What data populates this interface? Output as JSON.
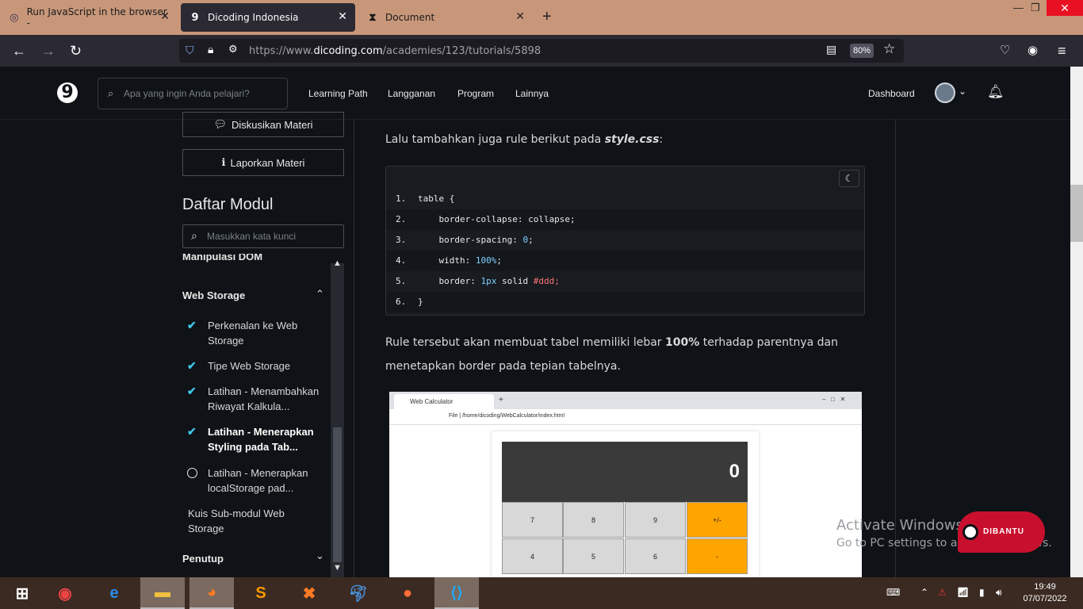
{
  "browser": {
    "tabs": [
      {
        "title": "Run JavaScript in the browser -",
        "icon": "code-icon"
      },
      {
        "title": "Dicoding Indonesia",
        "icon": "dicoding-icon"
      },
      {
        "title": "Document",
        "icon": "hourglass-icon"
      }
    ],
    "url_prefix": "https://www.",
    "url_domain": "dicoding.com",
    "url_path": "/academies/123/tutorials/5898",
    "zoom": "80%"
  },
  "header": {
    "logo": "9",
    "search_placeholder": "Apa yang ingin Anda pelajari?",
    "nav": [
      "Learning Path",
      "Langganan",
      "Program",
      "Lainnya"
    ],
    "dashboard": "Dashboard"
  },
  "sidebar": {
    "discuss_label": "Diskusikan Materi",
    "report_label": "Laporkan Materi",
    "title": "Daftar Modul",
    "search_placeholder": "Masukkan kata kunci",
    "prev_section": "Manipulasi DOM",
    "section": "Web Storage",
    "items": [
      {
        "label": "Perkenalan ke Web Storage",
        "done": true
      },
      {
        "label": "Tipe Web Storage",
        "done": true
      },
      {
        "label": "Latihan - Menambahkan Riwayat Kalkula...",
        "done": true
      },
      {
        "label": "Latihan - Menerapkan Styling pada Tab...",
        "done": true,
        "active": true
      },
      {
        "label": "Latihan - Menerapkan localStorage pad...",
        "done": false
      },
      {
        "label": "Kuis Sub-modul Web Storage",
        "done": false
      }
    ],
    "next_section": "Penutup"
  },
  "content": {
    "intro_prefix": "Lalu tambahkan juga rule berikut pada ",
    "intro_file": "style.css",
    "intro_suffix": ":",
    "code_lines": [
      {
        "n": "1.",
        "text": "table {"
      },
      {
        "n": "2.",
        "text": "    border-collapse: collapse;"
      },
      {
        "n": "3.",
        "pre": "    border-spacing: ",
        "num": "0",
        "post": ";"
      },
      {
        "n": "4.",
        "pre": "    width: ",
        "num": "100%",
        "post": ";"
      },
      {
        "n": "5.",
        "pre": "    border: ",
        "num": "1px",
        "post": " solid ",
        "red": "#ddd;"
      },
      {
        "n": "6.",
        "text": "}"
      }
    ],
    "rule_prefix": "Rule tersebut akan membuat tabel memiliki lebar ",
    "rule_bold": "100%",
    "rule_suffix": " terhadap parentnya dan",
    "rule_line2": "menetapkan border pada tepian tabelnya."
  },
  "screenshot": {
    "tab_title": "Web Calculator",
    "address": "File  |  /home/dicoding/WebCalculator/index.html",
    "display": "0",
    "keys_row1": [
      "7",
      "8",
      "9",
      "+/-"
    ],
    "keys_row2": [
      "4",
      "5",
      "6",
      "-"
    ]
  },
  "watermark": {
    "line1": "Activate Windows",
    "line2": "Go to PC settings to activate Windows."
  },
  "help_button": "DIBANTU",
  "taskbar": {
    "time": "19:49",
    "date": "07/07/2022"
  }
}
